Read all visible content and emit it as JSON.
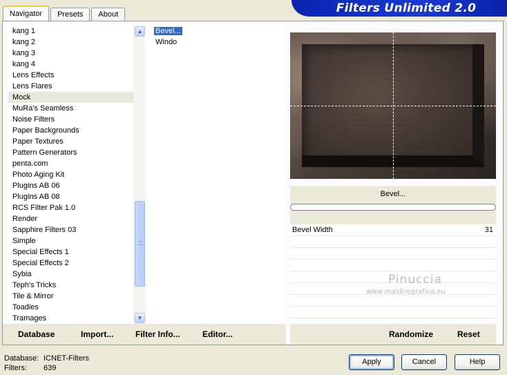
{
  "window": {
    "banner_title": "Filters Unlimited 2.0"
  },
  "tabs": [
    {
      "label": "Navigator",
      "active": true
    },
    {
      "label": "Presets",
      "active": false
    },
    {
      "label": "About",
      "active": false
    }
  ],
  "categories": {
    "items": [
      "kang 1",
      "kang 2",
      "kang 3",
      "kang 4",
      "Lens Effects",
      "Lens Flares",
      "Mock",
      "MuRa's Seamless",
      "Noise Filters",
      "Paper Backgrounds",
      "Paper Textures",
      "Pattern Generators",
      "penta.com",
      "Photo Aging Kit",
      "Plugins AB 06",
      "Plugins AB 08",
      "RCS Filter Pak 1.0",
      "Render",
      "Sapphire Filters 03",
      "Simple",
      "Special Effects 1",
      "Special Effects 2",
      "Sybia",
      "Teph's Tricks",
      "Tile & Mirror",
      "Toadies",
      "Tramages"
    ],
    "selected": "Mock"
  },
  "filters": {
    "items": [
      "Bevel...",
      "Windo"
    ],
    "selected": "Bevel..."
  },
  "preview": {
    "filter_name": "Bevel..."
  },
  "params": [
    {
      "name": "Bevel Width",
      "value": "31"
    }
  ],
  "watermark": {
    "line1": "Pinuccia",
    "line2": "www.maidiregrafica.eu"
  },
  "left_buttons": {
    "database": "Database",
    "import": "Import...",
    "filter_info": "Filter Info...",
    "editor": "Editor..."
  },
  "right_buttons": {
    "randomize": "Randomize",
    "reset": "Reset"
  },
  "status": {
    "database_label": "Database:",
    "database_value": "ICNET-Filters",
    "filters_label": "Filters:",
    "filters_value": "639"
  },
  "dialog_buttons": {
    "apply": "Apply",
    "cancel": "Cancel",
    "help": "Help"
  }
}
